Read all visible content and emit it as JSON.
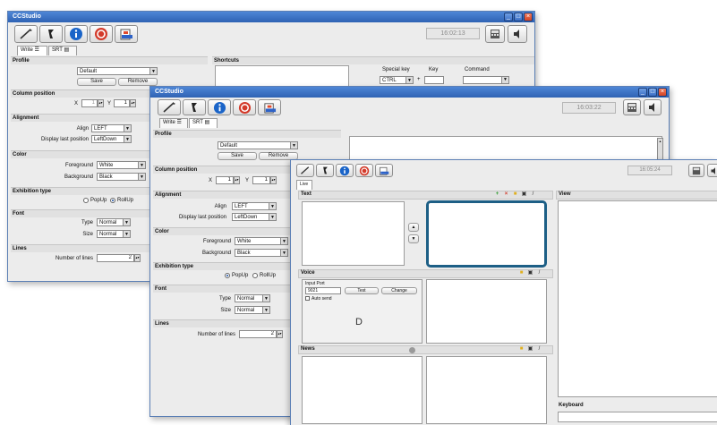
{
  "toolbar_icons": [
    "wand-icon",
    "pointer-icon",
    "info-icon",
    "stop-icon",
    "export-icon",
    "calculator-icon",
    "speaker-icon"
  ],
  "colors": {
    "titlebar": "#2f63b4",
    "selected_border": "#1d5f86",
    "info": "#1a64c8",
    "stop": "#d33a2a"
  },
  "win1": {
    "title": "CCStudio",
    "clock": "16:02:13",
    "tabs": [
      "Write",
      "SRT"
    ],
    "profile": {
      "section": "Profile",
      "selected": "Default",
      "save": "Save",
      "remove": "Remove"
    },
    "shortcuts": {
      "section": "Shortcuts",
      "special_key_label": "Special key",
      "key_label": "Key",
      "command_label": "Command",
      "special_key_value": "CTRL",
      "plus": "+"
    },
    "column_position": {
      "section": "Column position",
      "x_label": "X",
      "x_value": "1",
      "y_label": "Y",
      "y_value": "1"
    },
    "alignment": {
      "section": "Alignment",
      "align_label": "Align",
      "align_value": "LEFT",
      "display_label": "Display last position",
      "display_value": "LeftDown"
    },
    "color": {
      "section": "Color",
      "fg_label": "Foreground",
      "fg_value": "White",
      "bg_label": "Background",
      "bg_value": "Black"
    },
    "exhibition": {
      "section": "Exhibition type",
      "popup": "PopUp",
      "rollup": "RollUp"
    },
    "font": {
      "section": "Font",
      "type_label": "Type",
      "type_value": "Normal",
      "size_label": "Size",
      "size_value": "Normal"
    },
    "lines": {
      "section": "Lines",
      "number_label": "Number of lines",
      "number_value": "2"
    }
  },
  "win2": {
    "title": "CCStudio",
    "clock": "16:03:22",
    "tabs": [
      "Write",
      "SRT"
    ],
    "profile": {
      "section": "Profile",
      "selected": "Default",
      "save": "Save",
      "remove": "Remove"
    },
    "column_position": {
      "section": "Column position",
      "x_label": "X",
      "x_value": "1",
      "y_label": "Y",
      "y_value": "1"
    },
    "alignment": {
      "section": "Alignment",
      "align_label": "Align",
      "align_value": "LEFT",
      "display_label": "Display last position",
      "display_value": "LeftDown"
    },
    "color": {
      "section": "Color",
      "fg_label": "Foreground",
      "fg_value": "White",
      "bg_label": "Background",
      "bg_value": "Black"
    },
    "exhibition": {
      "section": "Exhibition type",
      "popup": "PopUp",
      "rollup": "RollUp"
    },
    "font": {
      "section": "Font",
      "type_label": "Type",
      "type_value": "Normal",
      "size_label": "Size",
      "size_value": "Normal"
    },
    "lines": {
      "section": "Lines",
      "number_label": "Number of lines",
      "number_value": "2"
    }
  },
  "win3": {
    "clock": "16:05:24",
    "tab": "Live",
    "text": {
      "title": "Text"
    },
    "view": {
      "title": "View"
    },
    "voice": {
      "title": "Voice",
      "input_port_label": "Input Port",
      "port_value": "9021",
      "test": "Test",
      "change": "Change",
      "auto_send": "Auto send"
    },
    "news": {
      "title": "News"
    },
    "keyboard": {
      "title": "Keyboard"
    }
  }
}
